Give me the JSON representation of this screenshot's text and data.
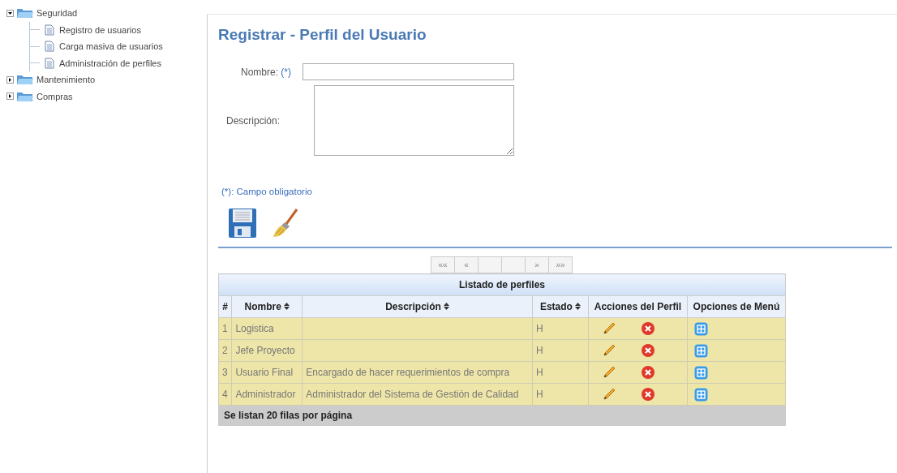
{
  "sidebar": {
    "items": [
      {
        "label": "Seguridad",
        "expanded": true,
        "children": [
          {
            "label": "Registro de usuarios"
          },
          {
            "label": "Carga masiva de usuarios"
          },
          {
            "label": "Administración de perfiles"
          }
        ]
      },
      {
        "label": "Mantenimiento",
        "expanded": false
      },
      {
        "label": "Compras",
        "expanded": false
      }
    ]
  },
  "page": {
    "title": "Registrar - Perfil del Usuario"
  },
  "form": {
    "fields": [
      {
        "kind": "text",
        "label": "Nombre:",
        "required_mark": "(*)"
      },
      {
        "kind": "textarea",
        "label": "Descripción:"
      }
    ],
    "note": "(*): Campo obligatorio",
    "actions": [
      {
        "kind": "save"
      },
      {
        "kind": "clear"
      }
    ]
  },
  "pager": {
    "buttons": [
      {
        "kind": "nav",
        "label": "««"
      },
      {
        "kind": "nav",
        "label": "«"
      },
      {
        "kind": "page"
      },
      {
        "kind": "page"
      },
      {
        "kind": "nav",
        "label": "»"
      },
      {
        "kind": "nav",
        "label": "»»"
      }
    ]
  },
  "table": {
    "caption": "Listado de perfiles",
    "columns": [
      {
        "label": "#",
        "sortable": false
      },
      {
        "label": "Nombre",
        "sortable": true
      },
      {
        "label": "Descripción",
        "sortable": true
      },
      {
        "label": "Estado",
        "sortable": true
      },
      {
        "label": "Acciones del Perfil",
        "sortable": false
      },
      {
        "label": "Opciones de Menú",
        "sortable": false
      }
    ],
    "rows": [
      {
        "index": "1",
        "name": "Logistica",
        "status": "H"
      },
      {
        "index": "2",
        "name": "Jefe Proyecto",
        "status": "H"
      },
      {
        "index": "3",
        "name": "Usuario Final",
        "description": "Encargado de hacer requerimientos de compra",
        "status": "H"
      },
      {
        "index": "4",
        "name": "Administrador",
        "description": "Administrador del Sistema de Gestión de Calidad",
        "status": "H"
      }
    ],
    "footer": "Se listan 20 filas por página"
  }
}
